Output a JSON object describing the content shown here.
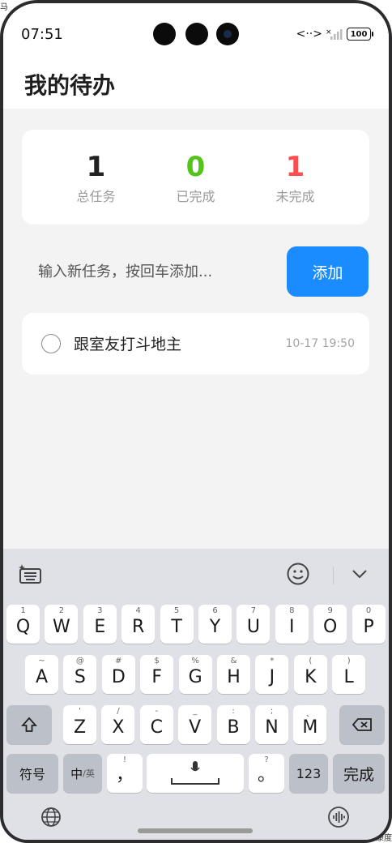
{
  "status_bar": {
    "time": "07:51",
    "battery": "100"
  },
  "page": {
    "title": "我的待办"
  },
  "stats": [
    {
      "value": "1",
      "label": "总任务",
      "color": "#222222"
    },
    {
      "value": "0",
      "label": "已完成",
      "color": "#52c41a"
    },
    {
      "value": "1",
      "label": "未完成",
      "color": "#ff4d4f"
    }
  ],
  "input": {
    "placeholder": "输入新任务，按回车添加...",
    "value": ""
  },
  "add_button": {
    "label": "添加",
    "color": "#1a8cff"
  },
  "tasks": [
    {
      "text": "跟室友打斗地主",
      "time": "10-17 19:50",
      "done": false
    }
  ],
  "edge": {
    "top_left": "马",
    "bottom_right": "康度"
  },
  "keyboard": {
    "row1": [
      {
        "main": "Q",
        "sub": "1"
      },
      {
        "main": "W",
        "sub": "2"
      },
      {
        "main": "E",
        "sub": "3"
      },
      {
        "main": "R",
        "sub": "4"
      },
      {
        "main": "T",
        "sub": "5"
      },
      {
        "main": "Y",
        "sub": "6"
      },
      {
        "main": "U",
        "sub": "7"
      },
      {
        "main": "I",
        "sub": "8"
      },
      {
        "main": "O",
        "sub": "9"
      },
      {
        "main": "P",
        "sub": "0"
      }
    ],
    "row2": [
      {
        "main": "A",
        "sub": "~"
      },
      {
        "main": "S",
        "sub": "@"
      },
      {
        "main": "D",
        "sub": "#"
      },
      {
        "main": "F",
        "sub": "$"
      },
      {
        "main": "G",
        "sub": "%"
      },
      {
        "main": "H",
        "sub": "&"
      },
      {
        "main": "J",
        "sub": "*"
      },
      {
        "main": "K",
        "sub": "("
      },
      {
        "main": "L",
        "sub": ")"
      }
    ],
    "row3": [
      {
        "main": "Z",
        "sub": "'"
      },
      {
        "main": "X",
        "sub": "/"
      },
      {
        "main": "C",
        "sub": "-"
      },
      {
        "main": "V",
        "sub": "_"
      },
      {
        "main": "B",
        "sub": ":"
      },
      {
        "main": "N",
        "sub": ";"
      },
      {
        "main": "M",
        "sub": "、"
      }
    ],
    "symbols_label": "符号",
    "lang_label": "中",
    "lang_sub": "/英",
    "comma": "，",
    "comma_sub": "!",
    "period": "。",
    "period_sub": "?",
    "num_label": "123",
    "done_label": "完成"
  }
}
